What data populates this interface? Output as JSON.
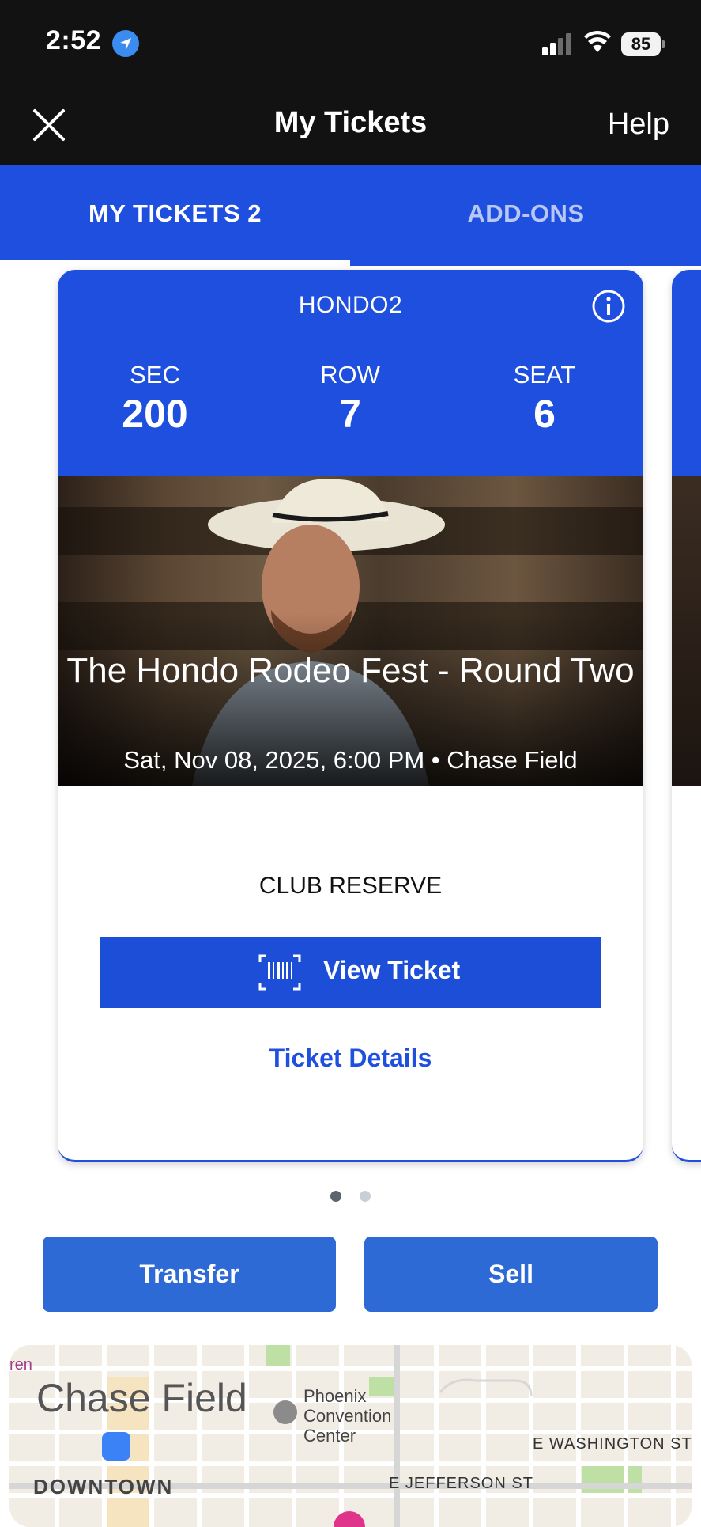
{
  "status_bar": {
    "time": "2:52",
    "battery": "85"
  },
  "nav": {
    "title": "My Tickets",
    "help": "Help"
  },
  "tabs": [
    {
      "label": "MY TICKETS 2"
    },
    {
      "label": "ADD-ONS"
    }
  ],
  "ticket": {
    "code": "HONDO2",
    "section": {
      "label": "SEC",
      "value": "200"
    },
    "row": {
      "label": "ROW",
      "value": "7"
    },
    "seat": {
      "label": "SEAT",
      "value": "6"
    },
    "event_title": "The Hondo Rodeo Fest - Round Two",
    "event_subtitle": "Sat, Nov 08, 2025, 6:00 PM • Chase Field",
    "seating_type": "CLUB RESERVE",
    "view_ticket": "View Ticket",
    "ticket_details": "Ticket Details"
  },
  "pager": {
    "pages": 2,
    "current": 1
  },
  "actions": {
    "transfer": "Transfer",
    "sell": "Sell"
  },
  "map": {
    "venue": "Chase Field",
    "poi": "Phoenix Convention Center",
    "streets": [
      "E WASHINGTON ST",
      "E JEFFERSON ST"
    ],
    "district": "DOWNTOWN",
    "partial": "ren"
  },
  "colors": {
    "brand_blue": "#1f4fde",
    "button_blue": "#2e6ad6",
    "status_bg": "#121212"
  }
}
